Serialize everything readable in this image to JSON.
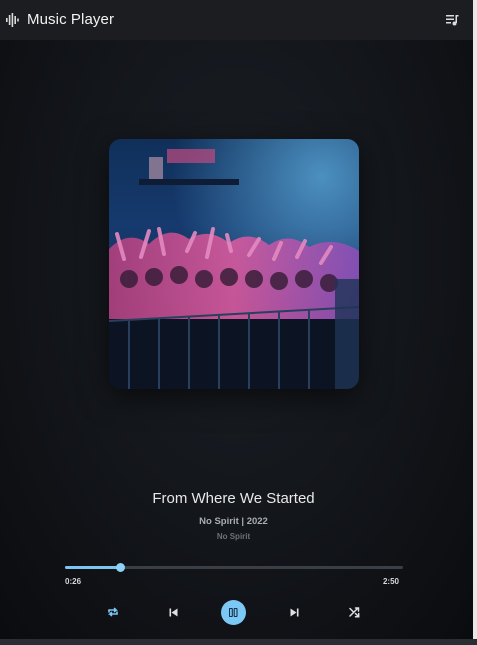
{
  "header": {
    "title": "Music Player",
    "logo_icon": "waveform-icon",
    "queue_icon": "playlist-icon"
  },
  "track": {
    "title": "From Where We Started",
    "meta": "No Spirit | 2022",
    "artist": "No Spirit",
    "artwork_alt": "concert-crowd-artwork"
  },
  "progress": {
    "current": "0:26",
    "total": "2:50",
    "fraction": 0.165
  },
  "controls": {
    "repeat_icon": "repeat-icon",
    "previous_icon": "skip-previous-icon",
    "play_pause_icon": "pause-icon",
    "next_icon": "skip-next-icon",
    "shuffle_icon": "shuffle-icon"
  },
  "colors": {
    "accent": "#7cc8f4",
    "background": "#14171c",
    "topbar": "#1b1d20"
  }
}
